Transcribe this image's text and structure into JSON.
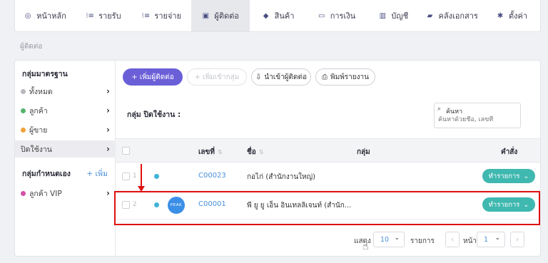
{
  "nav": {
    "items": [
      {
        "label": "หน้าหลัก",
        "icon": "home-icon",
        "glyph": "◎"
      },
      {
        "label": "รายรับ",
        "icon": "income-icon",
        "glyph": "⁝≡"
      },
      {
        "label": "รายจ่าย",
        "icon": "expense-icon",
        "glyph": "⁝≡"
      },
      {
        "label": "ผู้ติดต่อ",
        "icon": "contacts-icon",
        "glyph": "▣"
      },
      {
        "label": "สินค้า",
        "icon": "product-box-icon",
        "glyph": "◆"
      },
      {
        "label": "การเงิน",
        "icon": "money-icon",
        "glyph": "▭"
      },
      {
        "label": "บัญชี",
        "icon": "ledger-icon",
        "glyph": "▥"
      },
      {
        "label": "คลังเอกสาร",
        "icon": "folder-icon",
        "glyph": "▰"
      },
      {
        "label": "ตั้งค่า",
        "icon": "gear-icon",
        "glyph": "✱"
      }
    ],
    "active_index": 3
  },
  "breadcrumb": "ผู้ติดต่อ",
  "sidebar": {
    "standard_heading": "กลุ่มมาตรฐาน",
    "standard_items": [
      {
        "label": "ทั้งหมด",
        "color": "#b7b7bd"
      },
      {
        "label": "ลูกค้า",
        "color": "#56b36b"
      },
      {
        "label": "ผู้ขาย",
        "color": "#f1a33b"
      },
      {
        "label": "ปิดใช้งาน",
        "color": ""
      }
    ],
    "custom_heading": "กลุ่มกำหนดเอง",
    "add_label": "+ เพิ่ม",
    "custom_items": [
      {
        "label": "ลูกค้า VIP",
        "color": "#d44fa6"
      }
    ]
  },
  "toolbar": {
    "add_contact": "+ เพิ่มผู้ติดต่อ",
    "add_to_group": "+ เพิ่มเข้ากลุ่ม",
    "import_contacts": "นำเข้าผู้ติดต่อ",
    "print_report": "พิมพ์รายงาน"
  },
  "group_title": "กลุ่ม ปิดใช้งาน :",
  "search": {
    "label": "ค้นหา",
    "placeholder": "ค้นหาด้วยชื่อ, เลขที่"
  },
  "table": {
    "headers": {
      "number": "เลขที่",
      "name": "ชื่อ",
      "group": "กลุ่ม",
      "command": "คำสั่ง"
    },
    "rows": [
      {
        "index": "1",
        "code": "C00023",
        "name": "กอไก่ (สำนักงานใหญ่)",
        "avatar": "",
        "action": "ทำรายการ"
      },
      {
        "index": "2",
        "code": "C00001",
        "name": "พี ยู ยู เอ็น อินเทลลิเจนท์ (สำนัก...",
        "avatar": "PEAK",
        "action": "ทำรายการ"
      }
    ]
  },
  "pagination": {
    "show_label": "แสดง",
    "page_size": "10",
    "items_label": "รายการ",
    "page_label": "หน้า",
    "current_page": "1"
  },
  "colors": {
    "primary": "#6b5fd8",
    "action": "#3fb8b0",
    "link": "#4a90d9",
    "annotation": "#e01010"
  }
}
